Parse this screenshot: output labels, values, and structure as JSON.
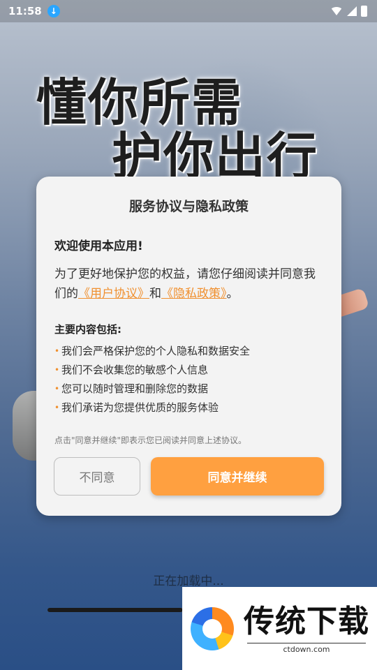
{
  "status_bar": {
    "time": "11:58",
    "icons": [
      "download-icon",
      "wifi-icon",
      "signal-icon",
      "battery-icon"
    ]
  },
  "slogan": {
    "line1": "懂你所需",
    "line2": "护你出行"
  },
  "dialog": {
    "title": "服务协议与隐私政策",
    "welcome": "欢迎使用本应用!",
    "intro_before": "为了更好地保护您的权益，请您仔细阅读并同意我们的",
    "user_agreement_link": "《用户协议》",
    "and": "和",
    "privacy_policy_link": "《隐私政策》",
    "intro_end": "。",
    "section_title": "主要内容包括:",
    "bullets": [
      "我们会严格保护您的个人隐私和数据安全",
      "我们不会收集您的敏感个人信息",
      "您可以随时管理和删除您的数据",
      "我们承诺为您提供优质的服务体验"
    ],
    "note": "点击\"同意并继续\"即表示您已阅读并同意上述协议。",
    "disagree_label": "不同意",
    "agree_label": "同意并继续"
  },
  "loading": {
    "text": "正在加载中...",
    "progress": 0.48
  },
  "watermark": {
    "name": "传统下载",
    "url": "ctdown.com"
  },
  "colors": {
    "accent": "#ffa040",
    "link": "#f0902f"
  }
}
